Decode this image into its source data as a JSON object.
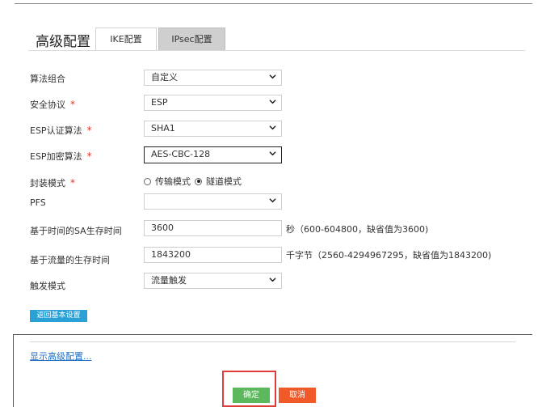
{
  "header": {
    "title": "高级配置",
    "tabs": [
      {
        "label": "IKE配置",
        "active": false
      },
      {
        "label": "IPsec配置",
        "active": true
      }
    ]
  },
  "form": {
    "algorithm_suite": {
      "label": "算法组合",
      "value": "自定义"
    },
    "security_protocol": {
      "label": "安全协议",
      "required_mark": "*",
      "value": "ESP"
    },
    "esp_auth": {
      "label": "ESP认证算法",
      "required_mark": "*",
      "value": "SHA1"
    },
    "esp_encrypt": {
      "label": "ESP加密算法",
      "required_mark": "*",
      "value": "AES-CBC-128"
    },
    "encap_mode": {
      "label": "封装模式",
      "required_mark": "*",
      "options": [
        {
          "label": "传输模式",
          "selected": false
        },
        {
          "label": "隧道模式",
          "selected": true
        }
      ]
    },
    "pfs": {
      "label": "PFS",
      "value": ""
    },
    "time_lifetime": {
      "label": "基于时间的SA生存时间",
      "value": "3600",
      "hint": "秒（600-604800，缺省值为3600)"
    },
    "traffic_lifetime": {
      "label": "基于流量的生存时间",
      "value": "1843200",
      "hint": "千字节（2560-4294967295，缺省值为1843200)"
    },
    "trigger_mode": {
      "label": "触发模式",
      "value": "流量触发"
    }
  },
  "buttons": {
    "back_basic": "返回基本设置",
    "show_advanced": "显示高级配置...",
    "ok": "确定",
    "cancel": "取消"
  },
  "colors": {
    "required": "#e0322a",
    "back_button": "#2aa1d6",
    "ok_button": "#5cb85c",
    "cancel_button": "#f05a28",
    "highlight": "#e23b3b",
    "link": "#1e6fc8"
  },
  "icons": {
    "select_arrow": "chevron-down-icon"
  }
}
